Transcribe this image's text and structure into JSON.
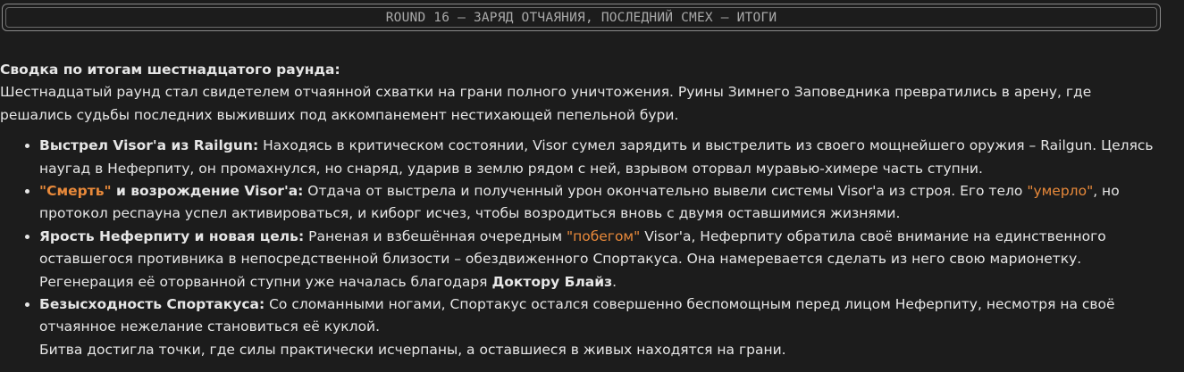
{
  "banner": {
    "title": "ROUND 16 – ЗАРЯД ОТЧАЯНИЯ, ПОСЛЕДНИЙ СМЕХ – ИТОГИ"
  },
  "summary": {
    "heading": "Сводка по итогам шестнадцатого раунда:",
    "intro": "Шестнадцатый раунд стал свидетелем отчаянной схватки на грани полного уничтожения. Руины Зимнего Заповедника превратились в арену, где решались судьбы последних выживших под аккомпанемент нестихающей пепельной бури."
  },
  "events": [
    {
      "title": "Выстрел Visor'а из Railgun:",
      "text": " Находясь в критическом состоянии, Visor сумел зарядить и выстрелить из своего мощнейшего оружия – Railgun. Целясь наугад в Неферпиту, он промахнулся, но снаряд, ударив в землю рядом с ней, взрывом оторвал муравью-химере часть ступни."
    },
    {
      "title_highlight": "\"Смерть\"",
      "title": " и возрождение Visor'а:",
      "text_before": " Отдача от выстрела и полученный урон окончательно вывели системы Visor'а из строя. Его тело ",
      "highlight": "\"умерло\"",
      "text_after": ", но протокол респауна успел активироваться, и киборг исчез, чтобы возродиться вновь с двумя оставшимися жизнями."
    },
    {
      "title": "Ярость Неферпиту и новая цель:",
      "text_before": " Раненая и взбешённая очередным ",
      "highlight": "\"побегом\"",
      "text_middle": " Visor'а, Неферпиту обратила своё внимание на единственного оставшегося противника в непосредственной близости – обездвиженного Спортакуса. Она намеревается сделать из него свою марионетку. Регенерация её оторванной ступни уже началась благодаря ",
      "bold_name": "Доктору Блайз",
      "text_after": "."
    },
    {
      "title": "Безысходность Спортакуса:",
      "text": " Со сломанными ногами, Спортакус остался совершенно беспомощным перед лицом Неферпиту, несмотря на своё отчаянное нежелание становиться её куклой.",
      "closing": "Битва достигла точки, где силы практически исчерпаны, а оставшиеся в живых находятся на грани."
    }
  ],
  "colors": {
    "background": "#1c1c1c",
    "text": "#e6e6e6",
    "highlight": "#e8893a",
    "banner_text": "#a9a9a9",
    "banner_border": "#8a8a8a"
  }
}
